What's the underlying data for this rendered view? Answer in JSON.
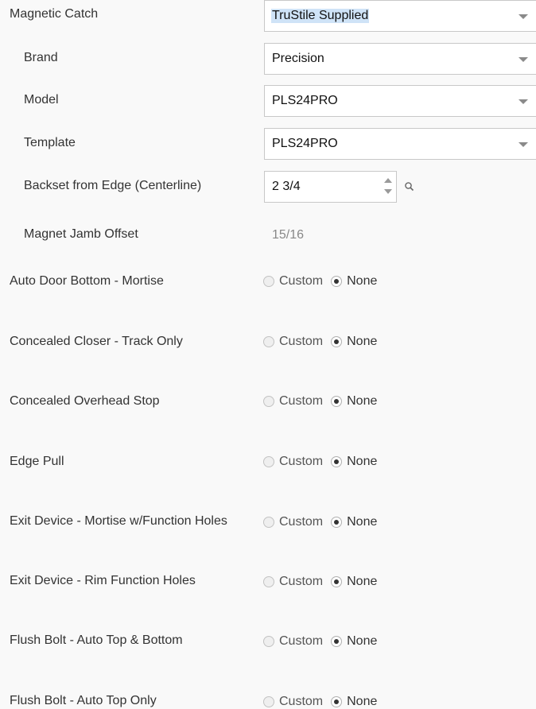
{
  "magnetic_catch": {
    "label": "Magnetic Catch",
    "value": "TruStile Supplied"
  },
  "brand": {
    "label": "Brand",
    "value": "Precision"
  },
  "model": {
    "label": "Model",
    "value": "PLS24PRO"
  },
  "template": {
    "label": "Template",
    "value": "PLS24PRO"
  },
  "backset": {
    "label": "Backset from Edge (Centerline)",
    "value": "2 3/4"
  },
  "jamb_offset": {
    "label": "Magnet Jamb Offset",
    "value": "15/16"
  },
  "radio_options": {
    "custom": "Custom",
    "none": "None"
  },
  "options": [
    {
      "label": "Auto Door Bottom - Mortise",
      "selected": "None"
    },
    {
      "label": "Concealed Closer - Track Only",
      "selected": "None"
    },
    {
      "label": "Concealed Overhead Stop",
      "selected": "None"
    },
    {
      "label": "Edge Pull",
      "selected": "None"
    },
    {
      "label": "Exit Device - Mortise w/Function Holes",
      "selected": "None"
    },
    {
      "label": "Exit Device - Rim Function Holes",
      "selected": "None"
    },
    {
      "label": "Flush Bolt - Auto Top & Bottom",
      "selected": "None"
    },
    {
      "label": "Flush Bolt - Auto Top Only",
      "selected": "None"
    }
  ],
  "colors": {
    "background": "#f9f9f9",
    "selection_highlight": "#cfe3f7",
    "muted_text": "#888888"
  }
}
